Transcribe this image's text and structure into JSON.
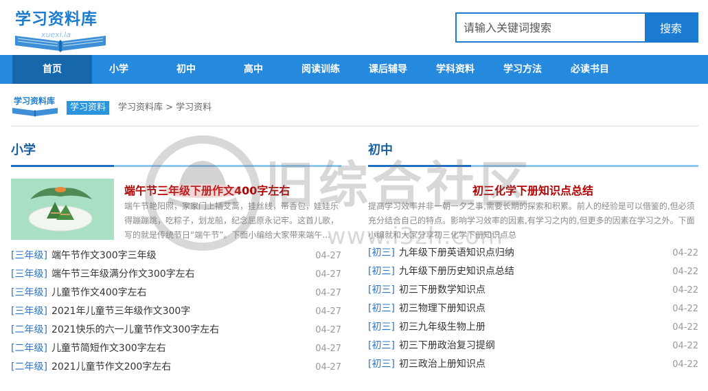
{
  "header": {
    "logo_text": "学习资料库",
    "logo_sub": "xuexi.la",
    "search_placeholder": "请输入关键词搜索",
    "search_button": "搜索"
  },
  "nav": {
    "items": [
      "首页",
      "小学",
      "初中",
      "高中",
      "阅读训练",
      "课后辅导",
      "学科资料",
      "学习方法",
      "必读书目"
    ],
    "active_index": 0
  },
  "breadcrumb": {
    "logo_text": "学习资料库",
    "tag": "学习资料",
    "path": "学习资料库 > 学习资料"
  },
  "sections": {
    "left": {
      "title": "小学",
      "featured_title": "端午节三年级下册作文400字左右",
      "featured_desc": "端午节艳阳照，家家门上插艾蒿，挂丝线，带香包，娃娃乐得蹦蹦跳，吃粽子，划龙船，纪念屈原永记牢。这首儿歌，写的就是传统节日“端午节”。下面小编给大家带来端午...",
      "items": [
        {
          "tag": "[三年级]",
          "title": "端午节作文300字三年级",
          "date": "04-27"
        },
        {
          "tag": "[三年级]",
          "title": "端午节三年级满分作文300字左右",
          "date": "04-27"
        },
        {
          "tag": "[三年级]",
          "title": "儿童节作文400字左右",
          "date": "04-27"
        },
        {
          "tag": "[三年级]",
          "title": "2021年儿童节三年级作文300字",
          "date": "04-27"
        },
        {
          "tag": "[二年级]",
          "title": "2021快乐的六一儿童节作文300字左右",
          "date": "04-27"
        },
        {
          "tag": "[二年级]",
          "title": "儿童节简短作文300字左右",
          "date": "04-27"
        },
        {
          "tag": "[二年级]",
          "title": "2021儿童节作文200字左右",
          "date": "04-27"
        }
      ]
    },
    "right": {
      "title": "初中",
      "featured_title": "初三化学下册知识点总结",
      "featured_desc": "提高学习效率并非一朝一夕之事,需要长期的探索和积累。前人的经验是可以借鉴的,但必须充分结合自己的特点。影响学习效率的因素,有学习之内的,但更多的因素在学习之外。下面小编就和大家分享初三化学下册知识点总",
      "items": [
        {
          "tag": "[初三]",
          "title": "九年级下册英语知识点归纳",
          "date": "04-22"
        },
        {
          "tag": "[初三]",
          "title": "九年级下册历史知识点总结",
          "date": "04-22"
        },
        {
          "tag": "[初三]",
          "title": "初三下册数学知识点",
          "date": "04-22"
        },
        {
          "tag": "[初三]",
          "title": "初三物理下册知识点",
          "date": "04-22"
        },
        {
          "tag": "[初三]",
          "title": "初三九年级生物上册",
          "date": "04-22"
        },
        {
          "tag": "[初三]",
          "title": "初三下册政治复习提纲",
          "date": "04-22"
        },
        {
          "tag": "[初三]",
          "title": "初三政治上册知识点",
          "date": "04-22"
        }
      ]
    }
  },
  "watermark": {
    "text": "旧综合社区",
    "url": "www.i3zh.com"
  },
  "colors": {
    "brand": "#1a7bd0",
    "nav_bg": "#2589dd",
    "nav_active": "#1667ab",
    "featured_title": "#b30000",
    "tag": "#2a73c8"
  }
}
